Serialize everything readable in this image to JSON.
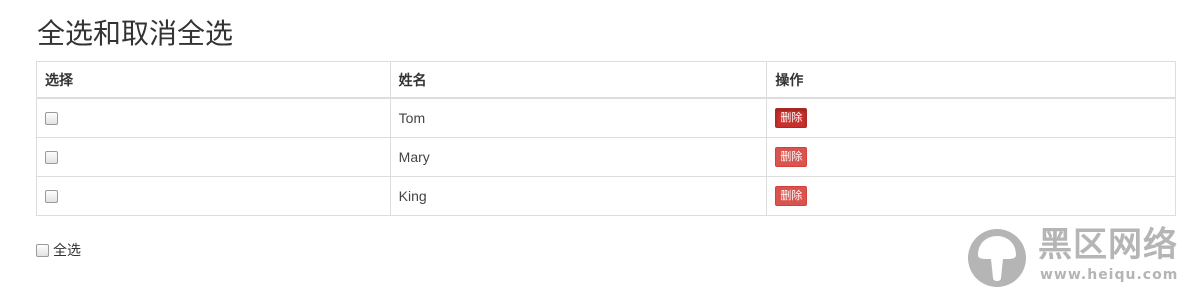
{
  "page": {
    "title": "全选和取消全选"
  },
  "table": {
    "headers": [
      "选择",
      "姓名",
      "操作"
    ],
    "rows": [
      {
        "checked": false,
        "name": "Tom",
        "action": "删除",
        "action_state": "active"
      },
      {
        "checked": false,
        "name": "Mary",
        "action": "删除",
        "action_state": "normal"
      },
      {
        "checked": false,
        "name": "King",
        "action": "删除",
        "action_state": "normal"
      }
    ]
  },
  "footer": {
    "select_all_label": "全选",
    "select_all_checked": false
  },
  "watermark": {
    "site_name": "黑区网络",
    "url": "www.heiqu.com"
  },
  "colors": {
    "danger": "#d9534f",
    "danger_active": "#c9302c",
    "border": "#dddddd",
    "watermark": "#b5b5b5"
  }
}
